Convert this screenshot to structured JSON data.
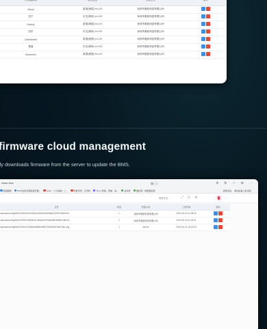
{
  "top_table": {
    "headers": [
      "可创建菜单",
      "语言类型",
      "所属公司",
      "操作"
    ],
    "rows": [
      {
        "menu": "About",
        "lang": "英语(美国) en-US",
        "company": "深圳市奥航科技有限公司"
      },
      {
        "menu": "关于",
        "lang": "中文(简体) zh-CN",
        "company": "深圳市奥航科技有限公司"
      },
      {
        "menu": "History",
        "lang": "英语(美国) en-US",
        "company": "深圳市奥航科技有限公司"
      },
      {
        "menu": "历史",
        "lang": "中文(简体) zh-CN",
        "company": "深圳市奥航科技有限公司"
      },
      {
        "menu": "Dashboard",
        "lang": "英语(美国) en-US",
        "company": "深圳市奥航科技有限公司"
      },
      {
        "menu": "表盘",
        "lang": "中文(简体) zh-CN",
        "company": "深圳市奥航科技有限公司"
      },
      {
        "menu": "Bluetooth",
        "lang": "英语(美国) en-US",
        "company": "深圳市奥航科技有限公司"
      }
    ]
  },
  "section": {
    "heading": "firmware cloud management",
    "subheading": "lly downloads firmware from the server to update the BMS."
  },
  "browser": {
    "tab_title": "/index.html",
    "center_icon": "⊞ ⓘ",
    "right_icons": [
      "A",
      "⇅",
      "☆",
      "⊕",
      "⋯"
    ],
    "bookmarks": [
      {
        "label": "百度翻译",
        "color": "#3d8fe6"
      },
      {
        "label": "BMS设置管理系统管理...",
        "color": "#3d8fe6"
      },
      {
        "label": "AIGC · 十六进制 · 二...",
        "color": "#e2483b"
      },
      {
        "label": "智能手表 · 日历新",
        "color": "#e2483b"
      },
      {
        "label": "Vben 表格、表单、动...",
        "color": "#7b61ff"
      },
      {
        "label": "在线表",
        "color": "#4caf50"
      },
      {
        "label": "图标库 - 阿里图标库",
        "color": "#4caf50"
      }
    ],
    "bookmarks_right": [
      "其他书签",
      "移动设备上的书签"
    ],
    "lang_selector": "简体中文",
    "tools": [
      "⤢",
      "↻",
      "⚙"
    ]
  },
  "file_table": {
    "headers": [
      "文件",
      "状态",
      "所属公司",
      "上传时间",
      "操作"
    ],
    "rows": [
      {
        "file": "/uploads/config/file/20230520/c4786a11801b811808bd0315976080f.bin",
        "status": "1",
        "company": "深圳市奥航科技有限公司",
        "time": "2023-05-20 11:08:40"
      },
      {
        "file": "/uploads/config/file/20230519/06061e7ab8a18760d6a8603968d7a6f.bin",
        "status": "1",
        "company": "深圳市奥航科技有限公司",
        "time": "2023-05-19 11:03:01"
      },
      {
        "file": "/uploads/config/file/20230411/e8066e689b0d507605618d75a0048c.png",
        "status": "1",
        "company": "admin",
        "time": "2023-04-11 18:23:00"
      }
    ]
  },
  "colors": {
    "edit": "#3d8fe6",
    "delete": "#e2483b",
    "background": "#061721"
  }
}
